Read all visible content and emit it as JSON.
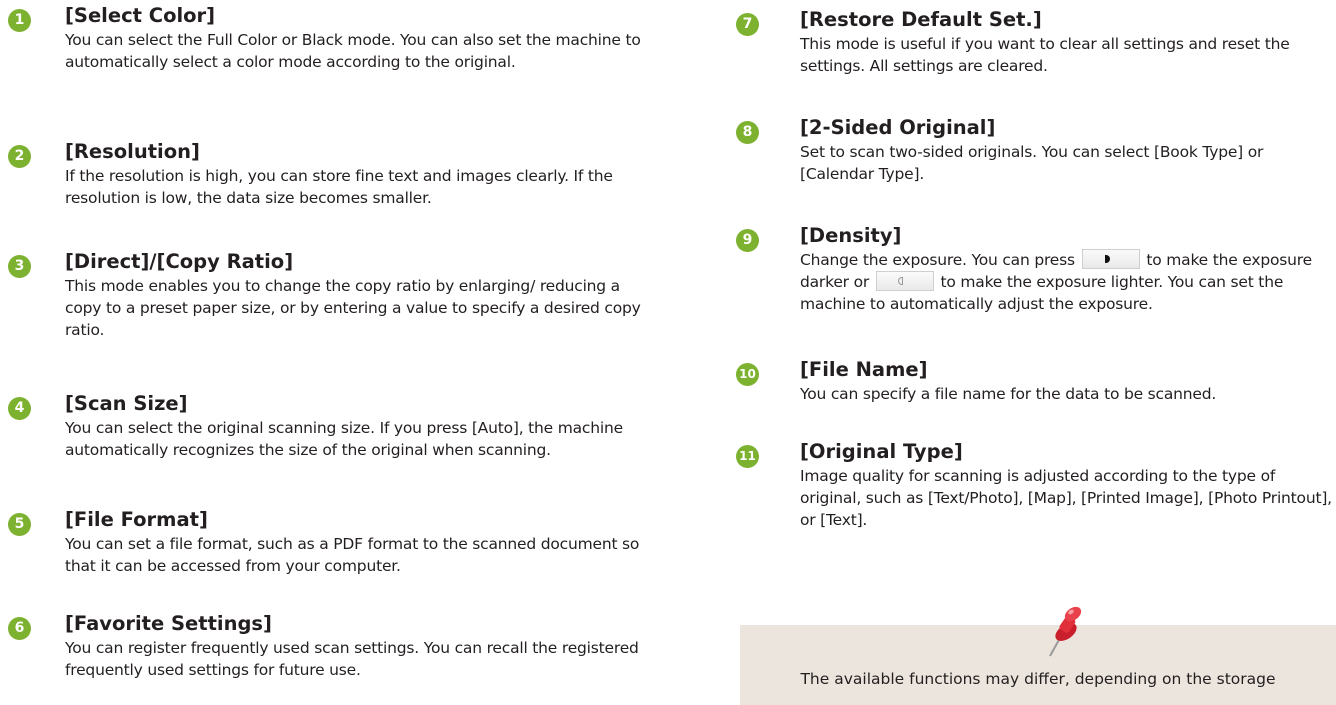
{
  "left_items": [
    {
      "num": "1",
      "title": "[Select Color]",
      "desc": "You can select the Full Color or Black mode. You can also set the machine to automatically select a color mode according to the original."
    },
    {
      "num": "2",
      "title": "[Resolution]",
      "desc": "If the resolution is high, you can store fine text and images clearly. If the resolution is low, the data size becomes smaller."
    },
    {
      "num": "3",
      "title": "[Direct]/[Copy Ratio]",
      "desc": "This mode enables you to change the copy ratio by enlarging/ reducing a copy to a preset paper size, or by entering a value to specify a desired copy ratio."
    },
    {
      "num": "4",
      "title": "[Scan Size]",
      "desc": "You can select the original scanning size. If you press [Auto], the machine automatically recognizes the size of the original when scanning."
    },
    {
      "num": "5",
      "title": "[File Format]",
      "desc": "You can set a file format, such as a PDF format to the scanned document so that it can be accessed from your computer."
    },
    {
      "num": "6",
      "title": "[Favorite Settings]",
      "desc": "You can register frequently used scan settings. You can recall the registered frequently used settings for future use."
    }
  ],
  "right_items": [
    {
      "num": "7",
      "title": "[Restore Default Set.]",
      "desc": "This mode is useful if you want to clear all settings and reset the settings. All settings are cleared."
    },
    {
      "num": "8",
      "title": "[2-Sided Original]",
      "desc": "Set to scan two-sided originals. You can select [Book Type] or [Calendar Type]."
    },
    {
      "num": "9",
      "title": "[Density]",
      "desc_a": "Change the exposure. You can press",
      "desc_b": "to make the exposure darker or",
      "desc_c": "to make the exposure lighter. You can set the machine to automatically adjust the exposure."
    },
    {
      "num": "10",
      "title": "[File Name]",
      "desc": "You can specify a file name for the data to be scanned."
    },
    {
      "num": "11",
      "title": "[Original Type]",
      "desc": "Image quality for scanning is adjusted according to the type of original, such as [Text/Photo], [Map], [Printed Image], [Photo Printout], or [Text]."
    }
  ],
  "note": {
    "text": "The available functions may differ, depending on the storage",
    "icon": "pushpin-icon"
  },
  "colors": {
    "badge": "#7cb230",
    "note_bg": "#ece5dd",
    "pin": "#e0313b"
  }
}
